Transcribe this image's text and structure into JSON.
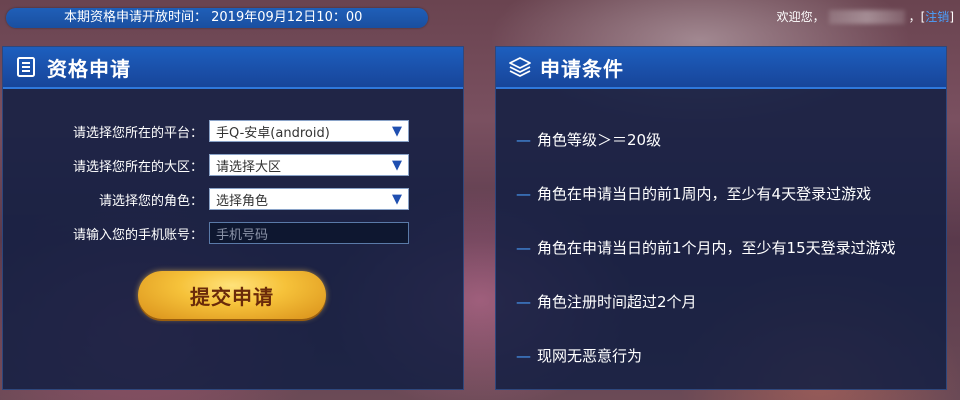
{
  "top": {
    "notice": "本期资格申请开放时间：  2019年09月12日10：00",
    "welcome": "欢迎您，",
    "comma": "，",
    "bracket_open": "[",
    "logout": "注销",
    "bracket_close": "]"
  },
  "apply_panel": {
    "title": "资格申请",
    "fields": [
      {
        "label": "请选择您所在的平台：",
        "value": "手Q-安卓(android)"
      },
      {
        "label": "请选择您所在的大区：",
        "value": "请选择大区"
      },
      {
        "label": "请选择您的角色：",
        "value": "选择角色"
      },
      {
        "label": "请输入您的手机账号：",
        "placeholder": "手机号码"
      }
    ],
    "submit": "提交申请",
    "caret_icon": "triangle-down-icon"
  },
  "conditions_panel": {
    "title": "申请条件",
    "items": [
      "角色等级＞＝20级",
      "角色在申请当日的前1周内，至少有4天登录过游戏",
      "角色在申请当日的前1个月内，至少有15天登录过游戏",
      "角色注册时间超过2个月",
      "现网无恶意行为"
    ],
    "bullet": "—"
  },
  "colors": {
    "accent_blue": "#1d5fbe",
    "link_blue": "#4aa0ff",
    "gold": "#f6c23a"
  }
}
